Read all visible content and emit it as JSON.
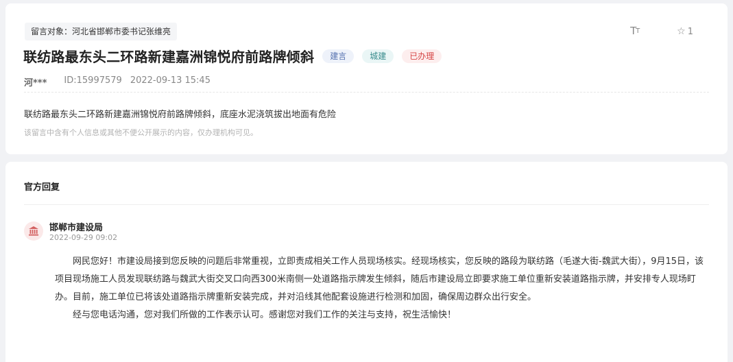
{
  "message": {
    "target_label": "留言对象：河北省邯郸市委书记张维亮",
    "title": "联纺路最东头二环路新建嘉洲锦悦府前路牌倾斜",
    "tags": [
      {
        "label": "建言",
        "color": "#5672b0"
      },
      {
        "label": "城建",
        "color": "#3a8d8e"
      },
      {
        "label": "已办理",
        "color": "#d64545"
      }
    ],
    "author": "河***",
    "id_text": "ID:15997579",
    "datetime": "2022-09-13 15:45",
    "content": "联纺路最东头二环路新建嘉洲锦悦府前路牌倾斜，底座水泥浇筑拔出地面有危险",
    "privacy_notice": "该留言中含有个人信息或其他不便公开展示的内容，仅办理机构可见。"
  },
  "toolbar": {
    "font_size_icon": "font-size-icon",
    "favorite_icon": "star-icon",
    "favorite_count": "1"
  },
  "reply": {
    "heading": "官方回复",
    "org_name": "邯郸市建设局",
    "org_icon": "government-building-icon",
    "datetime": "2022-09-29 09:02",
    "paragraphs": [
      "网民您好！市建设局接到您反映的问题后非常重视，立即责成相关工作人员现场核实。经现场核实，您反映的路段为联纺路（毛遂大街-魏武大街），9月15日，该项目现场施工人员发现联纺路与魏武大街交叉口向西300米南侧一处道路指示牌发生倾斜，随后市建设局立即要求施工单位重新安装道路指示牌，并安排专人现场盯办。目前，施工单位已将该处道路指示牌重新安装完成，并对沿线其他配套设施进行检测和加固，确保周边群众出行安全。",
      "经与您电话沟通，您对我们所做的工作表示认可。感谢您对我们工作的关注与支持，祝生活愉快！"
    ]
  }
}
